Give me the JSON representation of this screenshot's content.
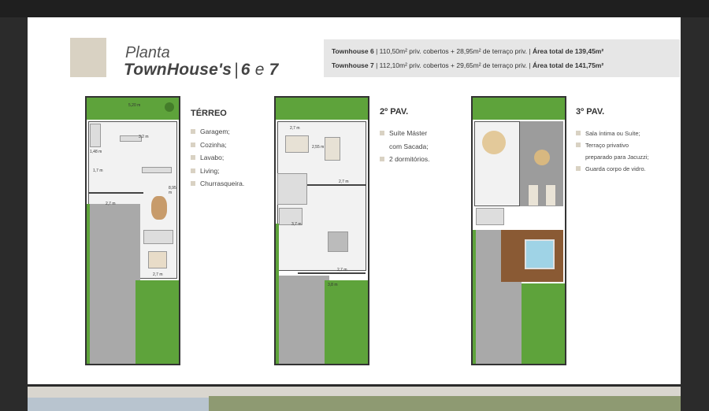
{
  "header": {
    "title_line1": "Planta",
    "title_line2_name": "TownHouse's",
    "title_line2_sep": "|",
    "title_line2_num_a": "6",
    "title_line2_e": "e",
    "title_line2_num_b": "7"
  },
  "info": {
    "row1": {
      "name": "Townhouse 6",
      "details": "110,50m² priv. cobertos + 28,95m² de terraço priv.",
      "total": "Área total de 139,45m²"
    },
    "row2": {
      "name": "Townhouse 7",
      "details": "112,10m² priv. cobertos + 29,65m² de terraço priv.",
      "total": "Área total de 141,75m²"
    },
    "separator": "|"
  },
  "floors": [
    {
      "title": "TÉRREO",
      "items": [
        "Garagem;",
        "Cozinha;",
        "Lavabo;",
        "Living;",
        "Churrasqueira."
      ],
      "dims": [
        "5,20 m",
        "3,2 m",
        "1,48 m",
        "1,7 m",
        "2,7 m",
        "8,95 m",
        "2,7 m"
      ]
    },
    {
      "title": "2º PAV.",
      "items": [
        "Suíte Máster",
        "com Sacada;",
        "2 dormitórios."
      ],
      "dims": [
        "2,7 m",
        "2,55 m",
        "2,7 m",
        "3,7 m",
        "2,7 m",
        "3,8 m"
      ]
    },
    {
      "title": "3º PAV.",
      "items": [
        "Sala íntima ou Suíte;",
        "Terraço privativo",
        "preparado para Jacuzzi;",
        "Guarda corpo de vidro."
      ]
    }
  ],
  "colors": {
    "accent": "#d9d2c3",
    "lawn": "#5ea33b",
    "info_bg": "#e6e6e6"
  }
}
